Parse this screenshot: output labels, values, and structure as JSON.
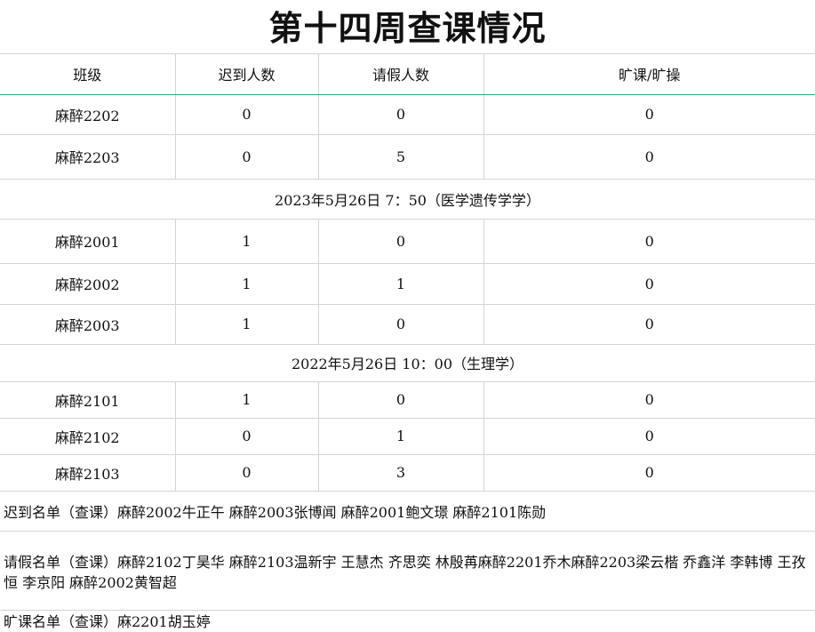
{
  "title": "第十四周查课情况",
  "headers": [
    "班级",
    "迟到人数",
    "请假人数",
    "旷课/旷操"
  ],
  "group1": [
    {
      "class": "麻醉2202",
      "late": "0",
      "leave": "0",
      "absent": "0"
    },
    {
      "class": "麻醉2203",
      "late": "0",
      "leave": "5",
      "absent": "0"
    }
  ],
  "session2": "2023年5月26日 7：50（医学遗传学学）",
  "group2": [
    {
      "class": "麻醉2001",
      "late": "1",
      "leave": "0",
      "absent": "0"
    },
    {
      "class": "麻醉2002",
      "late": "1",
      "leave": "1",
      "absent": "0"
    },
    {
      "class": "麻醉2003",
      "late": "1",
      "leave": "0",
      "absent": "0"
    }
  ],
  "session3": "2022年5月26日 10：00（生理学）",
  "group3": [
    {
      "class": "麻醉2101",
      "late": "1",
      "leave": "0",
      "absent": "0"
    },
    {
      "class": "麻醉2102",
      "late": "0",
      "leave": "1",
      "absent": "0"
    },
    {
      "class": "麻醉2103",
      "late": "0",
      "leave": "3",
      "absent": "0"
    }
  ],
  "notes": {
    "late_list": "迟到名单（查课）麻醉2002牛正午 麻醉2003张博闻 麻醉2001鲍文璟 麻醉2101陈勋",
    "leave_list": "请假名单（查课）麻醉2102丁昊华 麻醉2103温新宇 王慧杰 齐思奕 林殷苒麻醉2201乔木麻醉2203梁云楷 乔鑫洋 李韩博 王孜恒 李京阳 麻醉2002黄智超",
    "absent_list": "旷课名单（查课）麻2201胡玉婷"
  }
}
